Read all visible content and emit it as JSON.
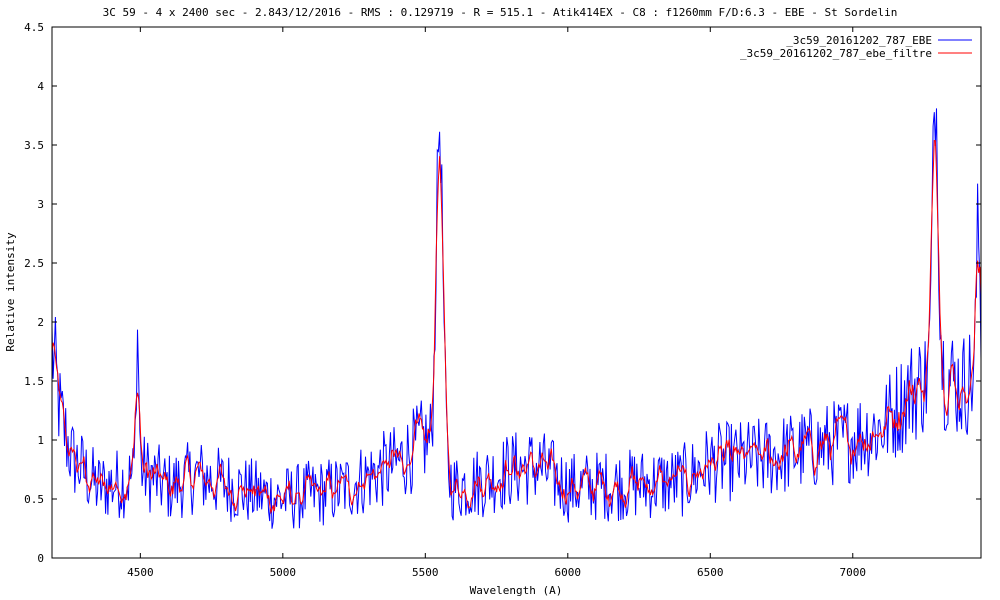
{
  "chart_data": {
    "type": "line",
    "title": "3C 59 - 4 x 2400 sec - 2.843/12/2016 - RMS : 0.129719 - R = 515.1 - Atik414EX - C8 : f1260mm F/D:6.3 - EBE - St Sordelin",
    "xlabel": "Wavelength (A)",
    "ylabel": "Relative intensity",
    "xlim": [
      4190,
      7450
    ],
    "ylim": [
      0,
      4.5
    ],
    "xticks": [
      4500,
      5000,
      5500,
      6000,
      6500,
      7000
    ],
    "yticks": [
      0,
      0.5,
      1,
      1.5,
      2,
      2.5,
      3,
      3.5,
      4,
      4.5
    ],
    "ytick_labels": [
      "0",
      "0.5",
      "1",
      "1.5",
      "2",
      "2.5",
      "3",
      "3.5",
      "4",
      "4.5"
    ],
    "grid": false,
    "legend": "top-right",
    "continuum_knots": {
      "x": [
        4190,
        4220,
        4260,
        4350,
        4450,
        4500,
        4600,
        4700,
        4800,
        4900,
        5000,
        5200,
        5400,
        5500,
        5600,
        5700,
        5800,
        5900,
        6000,
        6200,
        6400,
        6500,
        6700,
        6900,
        7100,
        7200,
        7300,
        7380,
        7450
      ],
      "y": [
        1.8,
        1.2,
        0.85,
        0.6,
        0.65,
        0.75,
        0.6,
        0.7,
        0.62,
        0.55,
        0.5,
        0.58,
        0.8,
        1.0,
        0.6,
        0.65,
        0.75,
        0.78,
        0.6,
        0.62,
        0.65,
        0.8,
        0.85,
        0.95,
        1.1,
        1.4,
        1.6,
        1.45,
        1.6
      ]
    },
    "emission_lines": [
      {
        "x": 5550,
        "peak": 3.65,
        "width": 12
      },
      {
        "x": 7290,
        "peak": 3.95,
        "width": 10
      },
      {
        "x": 4490,
        "peak": 1.9,
        "width": 5
      },
      {
        "x": 7440,
        "peak": 2.8,
        "width": 6
      }
    ],
    "noise_amplitude": 0.38,
    "sample_step": 4,
    "series": [
      {
        "name": "_3c59_20161202_787_EBE",
        "color": "#0000ff",
        "kind": "raw"
      },
      {
        "name": "_3c59_20161202_787_ebe_filtre",
        "color": "#ff0000",
        "kind": "filtered"
      }
    ]
  }
}
